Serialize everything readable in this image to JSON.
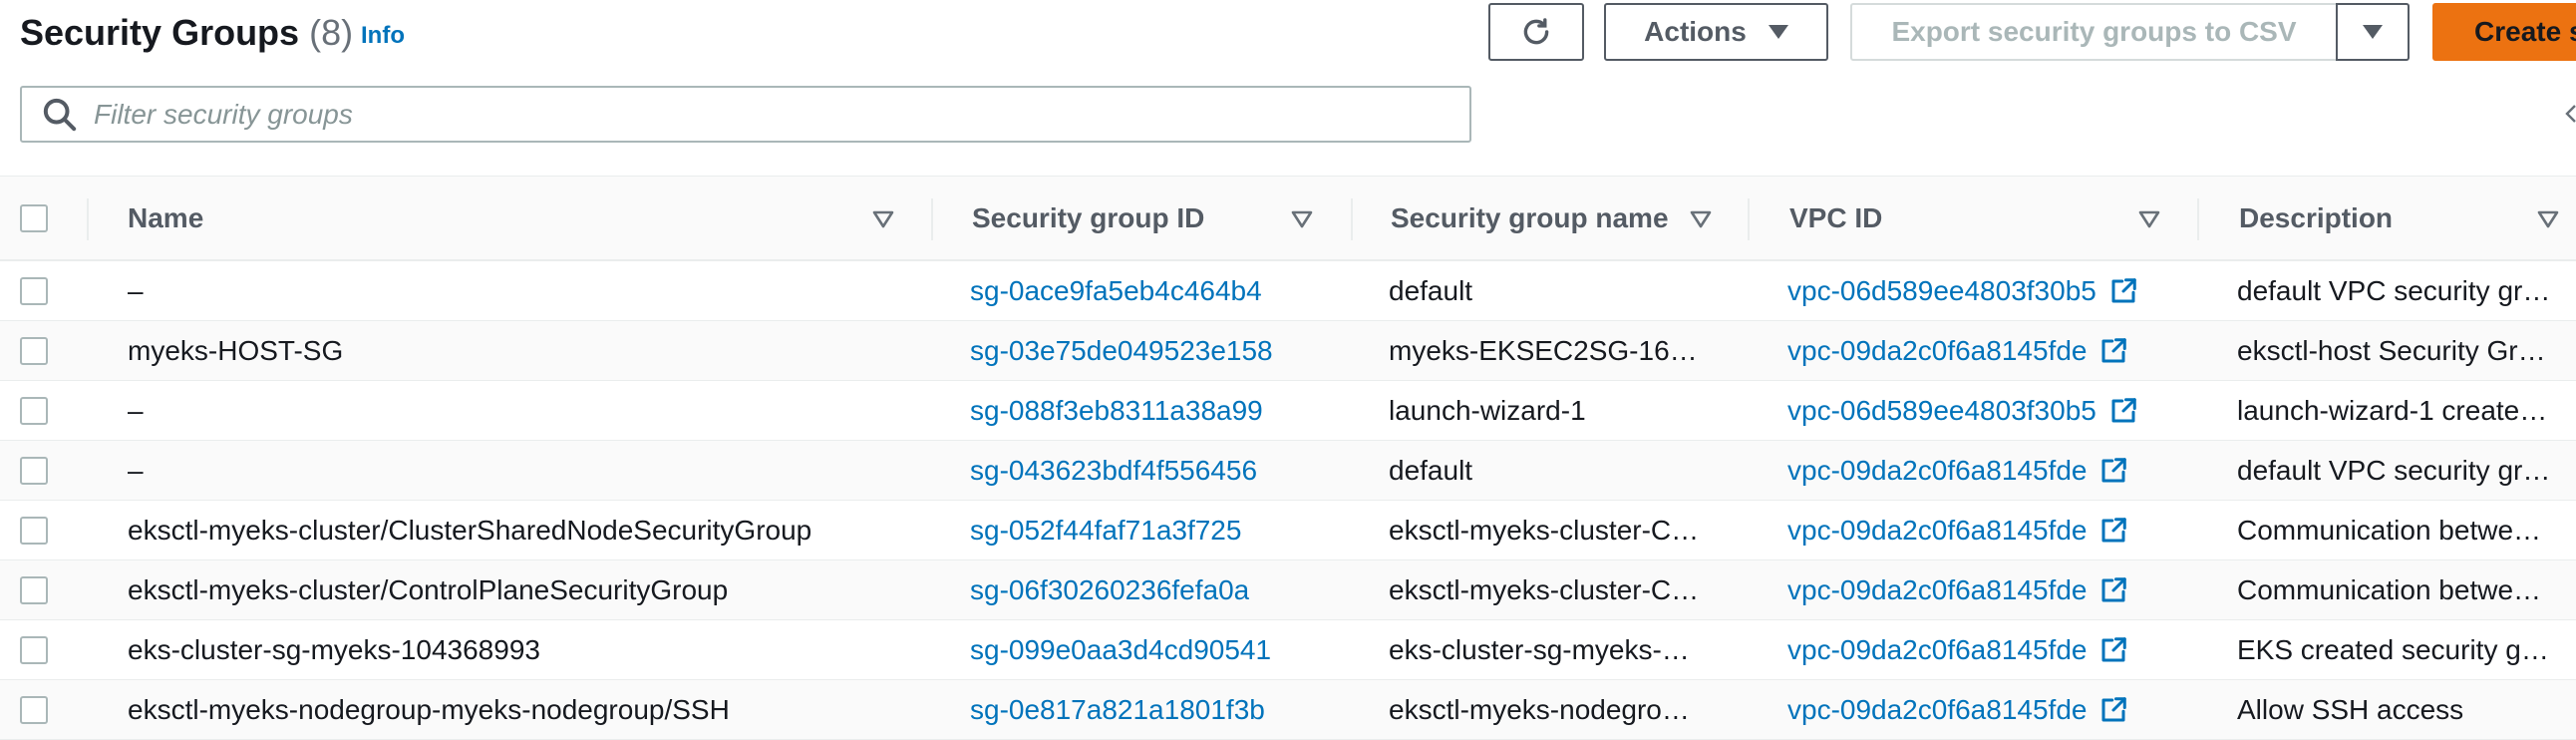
{
  "header": {
    "title": "Security Groups",
    "count": "(8)",
    "info_label": "Info"
  },
  "toolbar": {
    "actions_label": "Actions",
    "export_label": "Export security groups to CSV",
    "create_label": "Create s"
  },
  "filter": {
    "placeholder": "Filter security groups",
    "value": ""
  },
  "table": {
    "columns": [
      "Name",
      "Security group ID",
      "Security group name",
      "VPC ID",
      "Description"
    ],
    "rows": [
      {
        "name": "–",
        "sg_id": "sg-0ace9fa5eb4c464b4",
        "sg_name": "default",
        "vpc_id": "vpc-06d589ee4803f30b5",
        "description": "default VPC security gr…"
      },
      {
        "name": "myeks-HOST-SG",
        "sg_id": "sg-03e75de049523e158",
        "sg_name": "myeks-EKSEC2SG-16N…",
        "vpc_id": "vpc-09da2c0f6a8145fde",
        "description": "eksctl-host Security Gr…"
      },
      {
        "name": "–",
        "sg_id": "sg-088f3eb8311a38a99",
        "sg_name": "launch-wizard-1",
        "vpc_id": "vpc-06d589ee4803f30b5",
        "description": "launch-wizard-1 create…"
      },
      {
        "name": "–",
        "sg_id": "sg-043623bdf4f556456",
        "sg_name": "default",
        "vpc_id": "vpc-09da2c0f6a8145fde",
        "description": "default VPC security gr…"
      },
      {
        "name": "eksctl-myeks-cluster/ClusterSharedNodeSecurityGroup",
        "sg_id": "sg-052f44faf71a3f725",
        "sg_name": "eksctl-myeks-cluster-C…",
        "vpc_id": "vpc-09da2c0f6a8145fde",
        "description": "Communication betwe…"
      },
      {
        "name": "eksctl-myeks-cluster/ControlPlaneSecurityGroup",
        "sg_id": "sg-06f30260236fefa0a",
        "sg_name": "eksctl-myeks-cluster-C…",
        "vpc_id": "vpc-09da2c0f6a8145fde",
        "description": "Communication betwe…"
      },
      {
        "name": "eks-cluster-sg-myeks-104368993",
        "sg_id": "sg-099e0aa3d4cd90541",
        "sg_name": "eks-cluster-sg-myeks-…",
        "vpc_id": "vpc-09da2c0f6a8145fde",
        "description": "EKS created security gr…"
      },
      {
        "name": "eksctl-myeks-nodegroup-myeks-nodegroup/SSH",
        "sg_id": "sg-0e817a821a1801f3b",
        "sg_name": "eksctl-myeks-nodegro…",
        "vpc_id": "vpc-09da2c0f6a8145fde",
        "description": "Allow SSH access"
      }
    ]
  },
  "colors": {
    "link": "#0073bb",
    "primary_button": "#ec7211",
    "border": "#aab7b8",
    "header_text": "#545b64"
  },
  "icons": {
    "refresh": "refresh-icon",
    "search": "search-icon",
    "sort": "sort-icon",
    "external_link": "external-link-icon",
    "dropdown": "caret-down-icon"
  }
}
